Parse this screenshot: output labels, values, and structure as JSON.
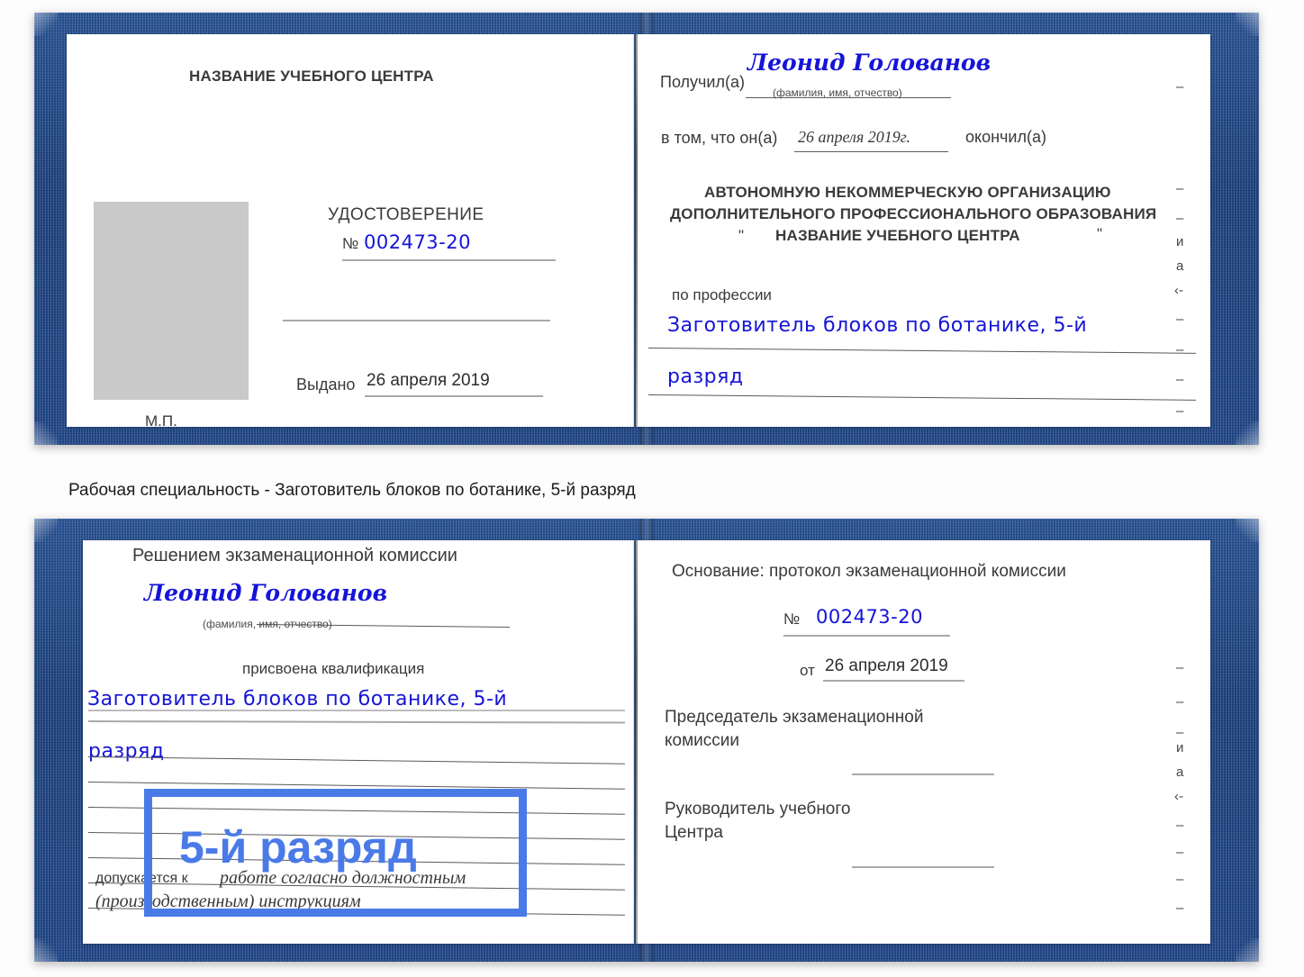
{
  "caption": {
    "text": "Рабочая специальность - Заготовитель блоков по ботанике, 5-й разряд"
  },
  "certificate_top": {
    "left_page": {
      "center_name": "НАЗВАНИЕ УЧЕБНОГО ЦЕНТРА",
      "doc_type": "УДОСТОВЕРЕНИЕ",
      "number_label": "№",
      "number_value": "002473-20",
      "issued_label": "Выдано",
      "issued_value": "26 апреля 2019",
      "seal_label": "М.П.",
      "photo_placeholder": "photo-placeholder"
    },
    "right_page": {
      "received_label": "Получил(а)",
      "received_value": "Леонид Голованов",
      "received_hint": "(фамилия, имя, отчество)",
      "that_he_label": "в том, что он(а)",
      "completion_date": "26 апреля 2019г.",
      "finished_label": "окончил(а)",
      "org_line1": "АВТОНОМНУЮ НЕКОММЕРЧЕСКУЮ ОРГАНИЗАЦИЮ",
      "org_line2": "ДОПОЛНИТЕЛЬНОГО ПРОФЕССИОНАЛЬНОГО ОБРАЗОВАНИЯ",
      "org_quote_open": "\"",
      "org_name": "НАЗВАНИЕ УЧЕБНОГО ЦЕНТРА",
      "org_quote_close": "\"",
      "profession_label": "по профессии",
      "profession_line1": "Заготовитель блоков по ботанике, 5-й",
      "profession_line2": "разряд",
      "margin_marks": [
        "–",
        "–",
        "–",
        "и",
        "а",
        "‹-",
        "–",
        "–",
        "–",
        "–"
      ]
    }
  },
  "certificate_bottom": {
    "left_page": {
      "decision_title": "Решением экзаменационной комиссии",
      "person_name": "Леонид Голованов",
      "name_hint": "(фамилия, имя, отчество)",
      "qualification_label": "присвоена квалификация",
      "qualification_line1": "Заготовитель блоков по ботанике, 5-й",
      "qualification_line2": "разряд",
      "admitted_label": "допускается к",
      "admitted_value_line1": "работе согласно должностным",
      "admitted_value_line2": "(производственным) инструкциям"
    },
    "right_page": {
      "basis_label": "Основание: протокол экзаменационной комиссии",
      "number_label": "№",
      "number_value": "002473-20",
      "from_label": "от",
      "from_value": "26 апреля 2019",
      "chairman_line1": "Председатель экзаменационной",
      "chairman_line2": "комиссии",
      "head_line1": "Руководитель учебного",
      "head_line2": "Центра",
      "margin_marks": [
        "–",
        "–",
        "–",
        "и",
        "а",
        "‹-",
        "–",
        "–",
        "–",
        "–"
      ]
    }
  },
  "annotation": {
    "highlight_text": "5-й разряд",
    "box_color": "#4a7ae8"
  },
  "colors": {
    "cover_blue": "#23498a",
    "handwriting_blue": "#1514d8",
    "highlight_blue": "#4a7ae8",
    "page_white": "#ffffff",
    "rule_gray": "#a9a9a9"
  }
}
